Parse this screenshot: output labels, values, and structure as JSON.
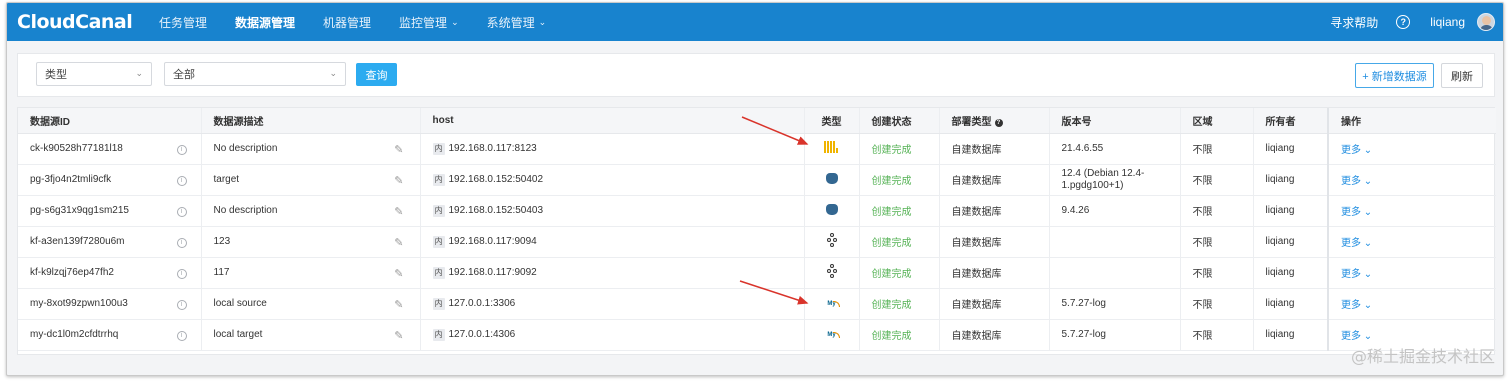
{
  "header": {
    "logo": "CloudCanal",
    "nav": [
      {
        "label": "任务管理",
        "dropdown": false,
        "active": false
      },
      {
        "label": "数据源管理",
        "dropdown": false,
        "active": true
      },
      {
        "label": "机器管理",
        "dropdown": false,
        "active": false
      },
      {
        "label": "监控管理",
        "dropdown": true,
        "active": false
      },
      {
        "label": "系统管理",
        "dropdown": true,
        "active": false
      }
    ],
    "help_label": "寻求帮助",
    "help_icon": "?",
    "user": "liqiang"
  },
  "filters": {
    "type_select": "类型",
    "scope_select": "全部",
    "query_button": "查询",
    "add_button": "+ 新增数据源",
    "refresh_button": "刷新"
  },
  "table": {
    "columns": [
      "数据源ID",
      "数据源描述",
      "host",
      "类型",
      "创建状态",
      "部署类型",
      "版本号",
      "区域",
      "所有者",
      "操作"
    ],
    "deploy_help_icon": "?",
    "rows": [
      {
        "id": "ck-k90528h77181l18",
        "desc": "No description",
        "host_tag": "内",
        "host": "192.168.0.117:8123",
        "type_icon": "clickhouse-icon",
        "status": "创建完成",
        "deploy": "自建数据库",
        "version": "21.4.6.55",
        "region": "不限",
        "owner": "liqiang",
        "action": "更多"
      },
      {
        "id": "pg-3fjo4n2tmli9cfk",
        "desc": "target",
        "host_tag": "内",
        "host": "192.168.0.152:50402",
        "type_icon": "postgresql-icon",
        "status": "创建完成",
        "deploy": "自建数据库",
        "version": "12.4 (Debian 12.4-1.pgdg100+1)",
        "region": "不限",
        "owner": "liqiang",
        "action": "更多"
      },
      {
        "id": "pg-s6g31x9qg1sm215",
        "desc": "No description",
        "host_tag": "内",
        "host": "192.168.0.152:50403",
        "type_icon": "postgresql-icon",
        "status": "创建完成",
        "deploy": "自建数据库",
        "version": "9.4.26",
        "region": "不限",
        "owner": "liqiang",
        "action": "更多"
      },
      {
        "id": "kf-a3en139f7280u6m",
        "desc": "123",
        "host_tag": "内",
        "host": "192.168.0.117:9094",
        "type_icon": "kafka-icon",
        "status": "创建完成",
        "deploy": "自建数据库",
        "version": "",
        "region": "不限",
        "owner": "liqiang",
        "action": "更多"
      },
      {
        "id": "kf-k9lzqj76ep47fh2",
        "desc": "117",
        "host_tag": "内",
        "host": "192.168.0.117:9092",
        "type_icon": "kafka-icon",
        "status": "创建完成",
        "deploy": "自建数据库",
        "version": "",
        "region": "不限",
        "owner": "liqiang",
        "action": "更多"
      },
      {
        "id": "my-8xot99zpwn100u3",
        "desc": "local source",
        "host_tag": "内",
        "host": "127.0.0.1:3306",
        "type_icon": "mysql-icon",
        "status": "创建完成",
        "deploy": "自建数据库",
        "version": "5.7.27-log",
        "region": "不限",
        "owner": "liqiang",
        "action": "更多"
      },
      {
        "id": "my-dc1l0m2cfdtrrhq",
        "desc": "local target",
        "host_tag": "内",
        "host": "127.0.0.1:4306",
        "type_icon": "mysql-icon",
        "status": "创建完成",
        "deploy": "自建数据库",
        "version": "5.7.27-log",
        "region": "不限",
        "owner": "liqiang",
        "action": "更多"
      }
    ]
  },
  "watermark": "@稀土掘金技术社区",
  "colors": {
    "header_bg": "#1883ce",
    "accent": "#2cabf0",
    "status_ok": "#55b255",
    "link": "#1f8de0",
    "annotation_arrow": "#d9342b"
  }
}
